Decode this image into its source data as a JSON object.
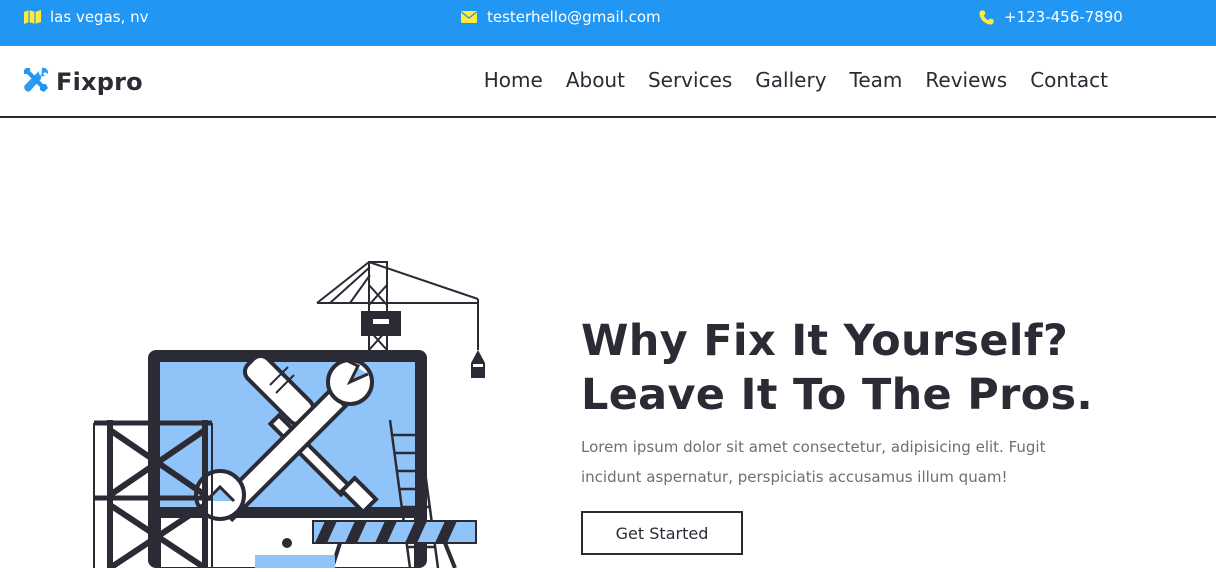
{
  "topbar": {
    "location": "las vegas, nv",
    "email": "testerhello@gmail.com",
    "phone": "+123-456-7890",
    "icon_color": "#ffeb3b",
    "background": "#2196f3"
  },
  "brand": {
    "name": "Fixpro",
    "icon": "tools-icon",
    "icon_color": "#2196f3"
  },
  "nav": {
    "items": [
      {
        "label": "Home"
      },
      {
        "label": "About"
      },
      {
        "label": "Services"
      },
      {
        "label": "Gallery"
      },
      {
        "label": "Team"
      },
      {
        "label": "Reviews"
      },
      {
        "label": "Contact"
      }
    ]
  },
  "hero": {
    "title_line1": "Why Fix It Yourself?",
    "title_line2": "Leave It To The Pros.",
    "description": "Lorem ipsum dolor sit amet consectetur, adipisicing elit. Fugit incidunt aspernatur, perspiciatis accusamus illum quam!",
    "cta_label": "Get Started",
    "illustration": "repair-tools-illustration",
    "accent_color": "#90c4f8"
  }
}
